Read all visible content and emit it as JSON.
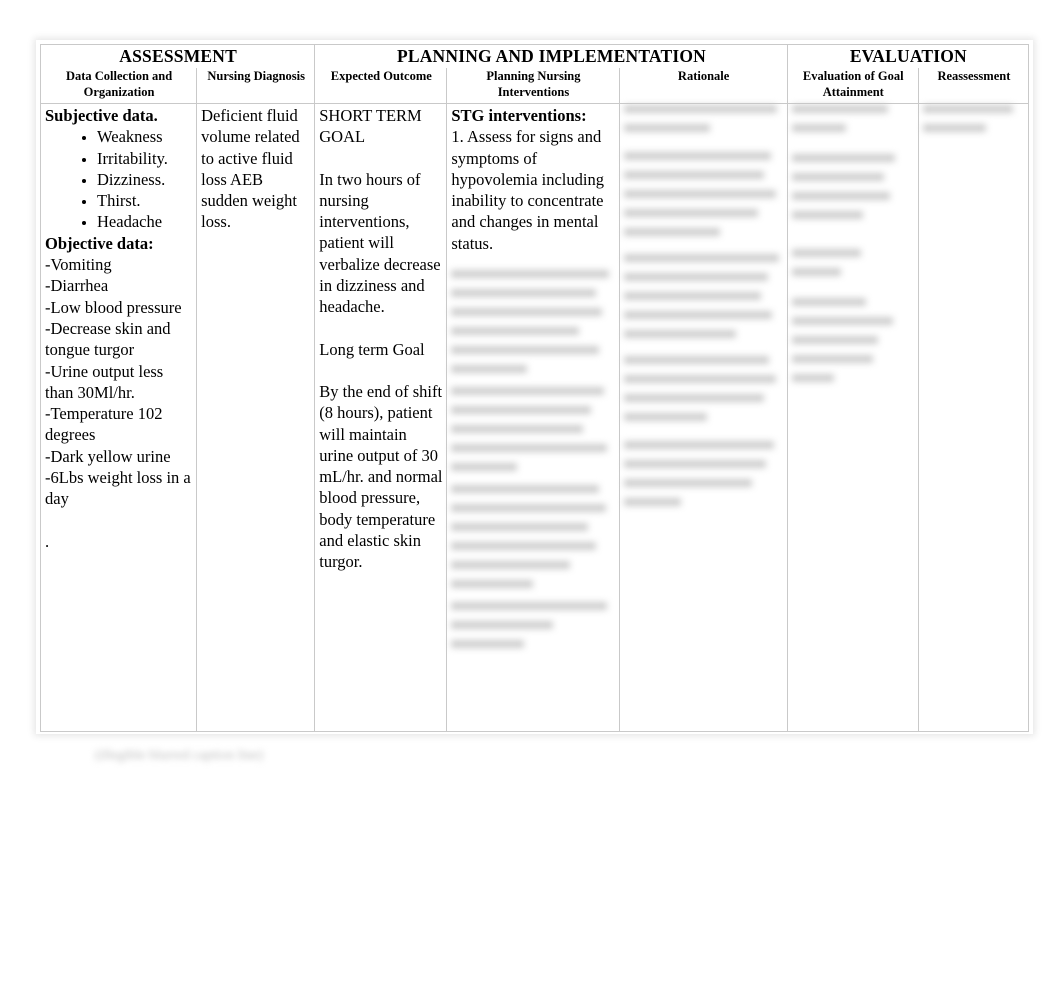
{
  "document": {
    "type": "nursing-care-plan-table",
    "caption_blurred": "(illegible blurred caption line)"
  },
  "table": {
    "group_headers": [
      {
        "label": "ASSESSMENT",
        "span": 2
      },
      {
        "label": "PLANNING AND IMPLEMENTATION",
        "span": 3
      },
      {
        "label": "EVALUATION",
        "span": 2
      }
    ],
    "column_headers": [
      "Data Collection and Organization",
      "Nursing Diagnosis",
      "Expected Outcome",
      "Planning Nursing Interventions",
      "Rationale",
      "Evaluation of Goal Attainment",
      "Reassessment"
    ],
    "cells": {
      "data_collection": {
        "subjective_heading": "Subjective data.",
        "subjective_bullets": [
          "Weakness",
          "Irritability.",
          "Dizziness.",
          "Thirst.",
          "Headache"
        ],
        "objective_heading": "Objective data:",
        "objective_lines": [
          "-Vomiting",
          "-Diarrhea",
          "-Low blood pressure",
          "-Decrease skin and tongue turgor",
          "-Urine output less than 30Ml/hr.",
          "-Temperature 102 degrees",
          "-Dark yellow urine",
          "-6Lbs weight loss in a day"
        ],
        "trailing_period": "."
      },
      "nursing_diagnosis": {
        "text": "Deficient fluid volume related to active fluid loss AEB sudden weight loss."
      },
      "expected_outcome": {
        "short_term_label": "SHORT TERM GOAL",
        "short_term_text": "In two hours of nursing interventions, patient will verbalize decrease in dizziness and headache.",
        "long_term_label": "Long term Goal",
        "long_term_text": "By the end of shift (8 hours), patient will maintain urine output of 30 mL/hr. and normal blood pressure, body temperature and elastic skin turgor."
      },
      "planning_interventions": {
        "heading": "STG interventions:",
        "item_1": "1. Assess for signs and symptoms of hypovolemia including inability to concentrate and changes in mental status.",
        "blurred_items": [
          "2. (blurred / illegible)",
          "3. (blurred / illegible)",
          "4. (blurred / illegible)",
          "5. (blurred / illegible)",
          "6. (blurred / illegible)"
        ]
      },
      "rationale": {
        "blurred_items": [
          "(blurred / illegible)",
          "(blurred / illegible)",
          "(blurred / illegible)",
          "(blurred / illegible)"
        ]
      },
      "evaluation_of_goal_attainment": {
        "blurred_items": [
          "(blurred / illegible)",
          "(blurred / illegible)",
          "(blurred / illegible)",
          "(blurred / illegible)"
        ]
      },
      "reassessment": {
        "blurred_items": [
          "(blurred / illegible)"
        ]
      }
    }
  }
}
